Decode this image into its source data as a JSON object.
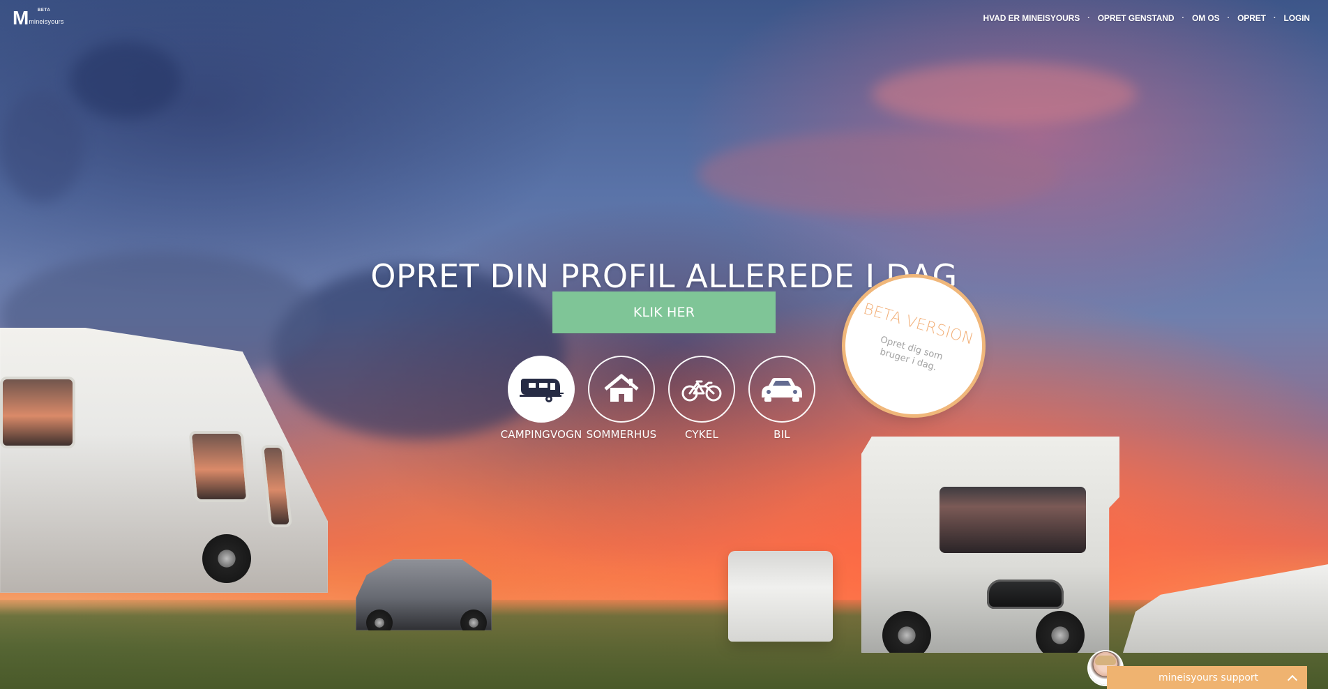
{
  "brand": {
    "logo_mark": "M",
    "beta_label": "BETA",
    "logo_text": "mineisyours"
  },
  "nav": {
    "items": [
      {
        "label": "HVAD ER MINEISYOURS"
      },
      {
        "label": "OPRET GENSTAND"
      },
      {
        "label": "OM OS"
      },
      {
        "label": "OPRET"
      },
      {
        "label": "LOGIN"
      }
    ],
    "separator": "·"
  },
  "hero": {
    "title": "OPRET DIN PROFIL ALLEREDE I DAG",
    "button_label": "KLIK HER"
  },
  "categories": {
    "items": [
      {
        "label": "CAMPINGVOGN",
        "icon": "caravan-icon",
        "active": true
      },
      {
        "label": "SOMMERHUS",
        "icon": "house-icon",
        "active": false
      },
      {
        "label": "CYKEL",
        "icon": "bicycle-icon",
        "active": false
      },
      {
        "label": "BIL",
        "icon": "car-icon",
        "active": false
      }
    ]
  },
  "badge": {
    "title": "BETA VERSION",
    "subtitle": "Opret dig som bruger i dag."
  },
  "support": {
    "label": "mineisyours support",
    "icon": "chevron-up-icon"
  },
  "colors": {
    "accent_green": "#7fc597",
    "accent_orange": "#efb370",
    "badge_ring": "#f0b77a",
    "white": "#ffffff"
  }
}
